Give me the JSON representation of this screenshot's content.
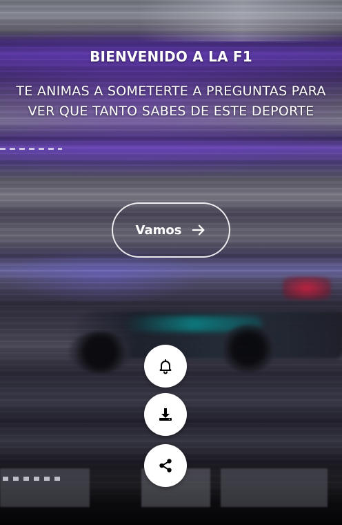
{
  "hero": {
    "title": "BIENVENIDO A LA F1",
    "subtitle": "TE ANIMAS A SOMETERTE A PREGUNTAS PARA VER QUE TANTO SABES DE ESTE DEPORTE"
  },
  "cta": {
    "label": "Vamos",
    "icon": "arrow-right-icon"
  },
  "actions": [
    {
      "name": "notifications",
      "icon": "bell-icon"
    },
    {
      "name": "download",
      "icon": "download-icon"
    },
    {
      "name": "share",
      "icon": "share-icon"
    }
  ],
  "colors": {
    "text": "#ffffff",
    "fab_background": "#ffffff",
    "fab_icon": "#000000",
    "accent_purple": "#5a3aa0"
  }
}
